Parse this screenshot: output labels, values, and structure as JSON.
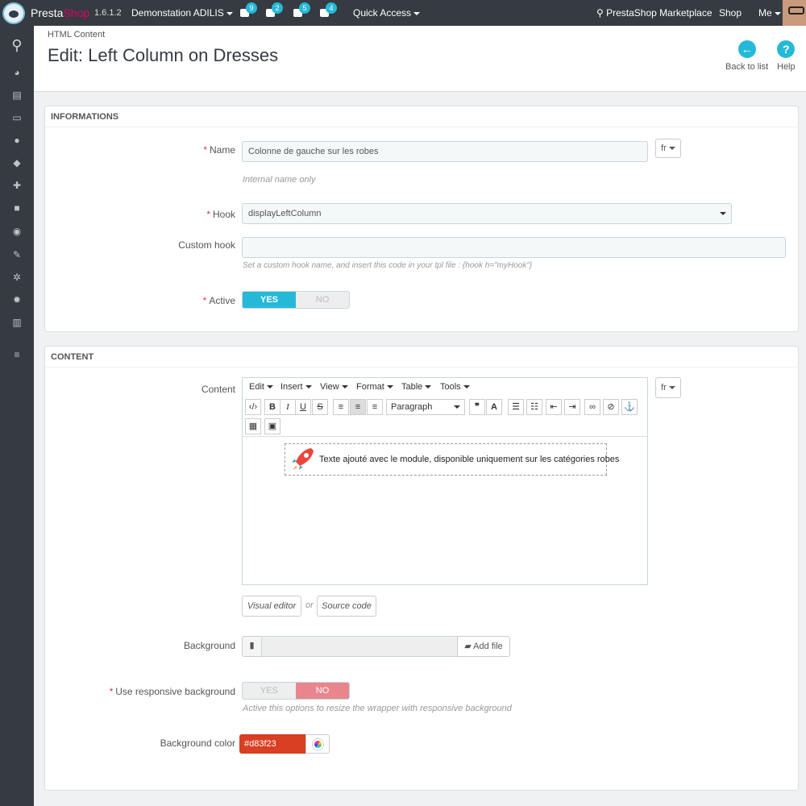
{
  "header": {
    "brand_part1": "Presta",
    "brand_part2": "Shop",
    "version": "1.6.1.2",
    "shop_name": "Demonstation ADILIS",
    "notifications": {
      "orders": "9",
      "customers": "2",
      "messages": "5",
      "trophies": "4"
    },
    "quick_access": "Quick Access",
    "marketplace": "PrestaShop Marketplace",
    "shop_link": "Shop",
    "me": "Me"
  },
  "sidebar": {
    "icons": [
      "search-icon",
      "dashboard-icon",
      "catalog-icon",
      "orders-icon",
      "customers-icon",
      "price-rules-icon",
      "modules-icon",
      "shipping-icon",
      "localization-icon",
      "preferences-icon",
      "advanced-parameters-icon",
      "administration-icon",
      "stats-icon",
      "menu-icon"
    ]
  },
  "page": {
    "breadcrumb": "HTML Content",
    "title": "Edit: Left Column on Dresses",
    "back_label": "Back to list",
    "help_label": "Help"
  },
  "informations": {
    "title": "INFORMATIONS",
    "name_label": "Name",
    "name_value": "Colonne de gauche sur les robes",
    "lang": "fr",
    "name_help": "Internal name only",
    "hook_label": "Hook",
    "hook_value": "displayLeftColumn",
    "custom_hook_label": "Custom hook",
    "custom_hook_value": "",
    "custom_hook_help": "Set a custom hook name, and insert this code in your tpl file : {hook h=\"myHook\"}",
    "active_label": "Active",
    "yes": "YES",
    "no": "NO"
  },
  "content": {
    "title": "CONTENT",
    "content_label": "Content",
    "lang": "fr",
    "menu": [
      "Edit",
      "Insert",
      "View",
      "Format",
      "Table",
      "Tools"
    ],
    "paragraph": "Paragraph",
    "editor_text": "Texte ajouté avec le module, disponible uniquement sur les catégories robes",
    "visual_editor": "Visual editor",
    "or": "or",
    "source_code": "Source code",
    "background_label": "Background",
    "add_file": "Add file",
    "responsive_label": "Use responsive background",
    "yes": "YES",
    "no": "NO",
    "responsive_help": "Active this options to resize the wrapper with responsive background",
    "bgcolor_label": "Background color",
    "bgcolor_value": "#d83f23"
  },
  "colors": {
    "accent": "#25b9d7",
    "danger": "#e0344a",
    "bg_color": "#d83f23",
    "topbar": "#363a41"
  }
}
